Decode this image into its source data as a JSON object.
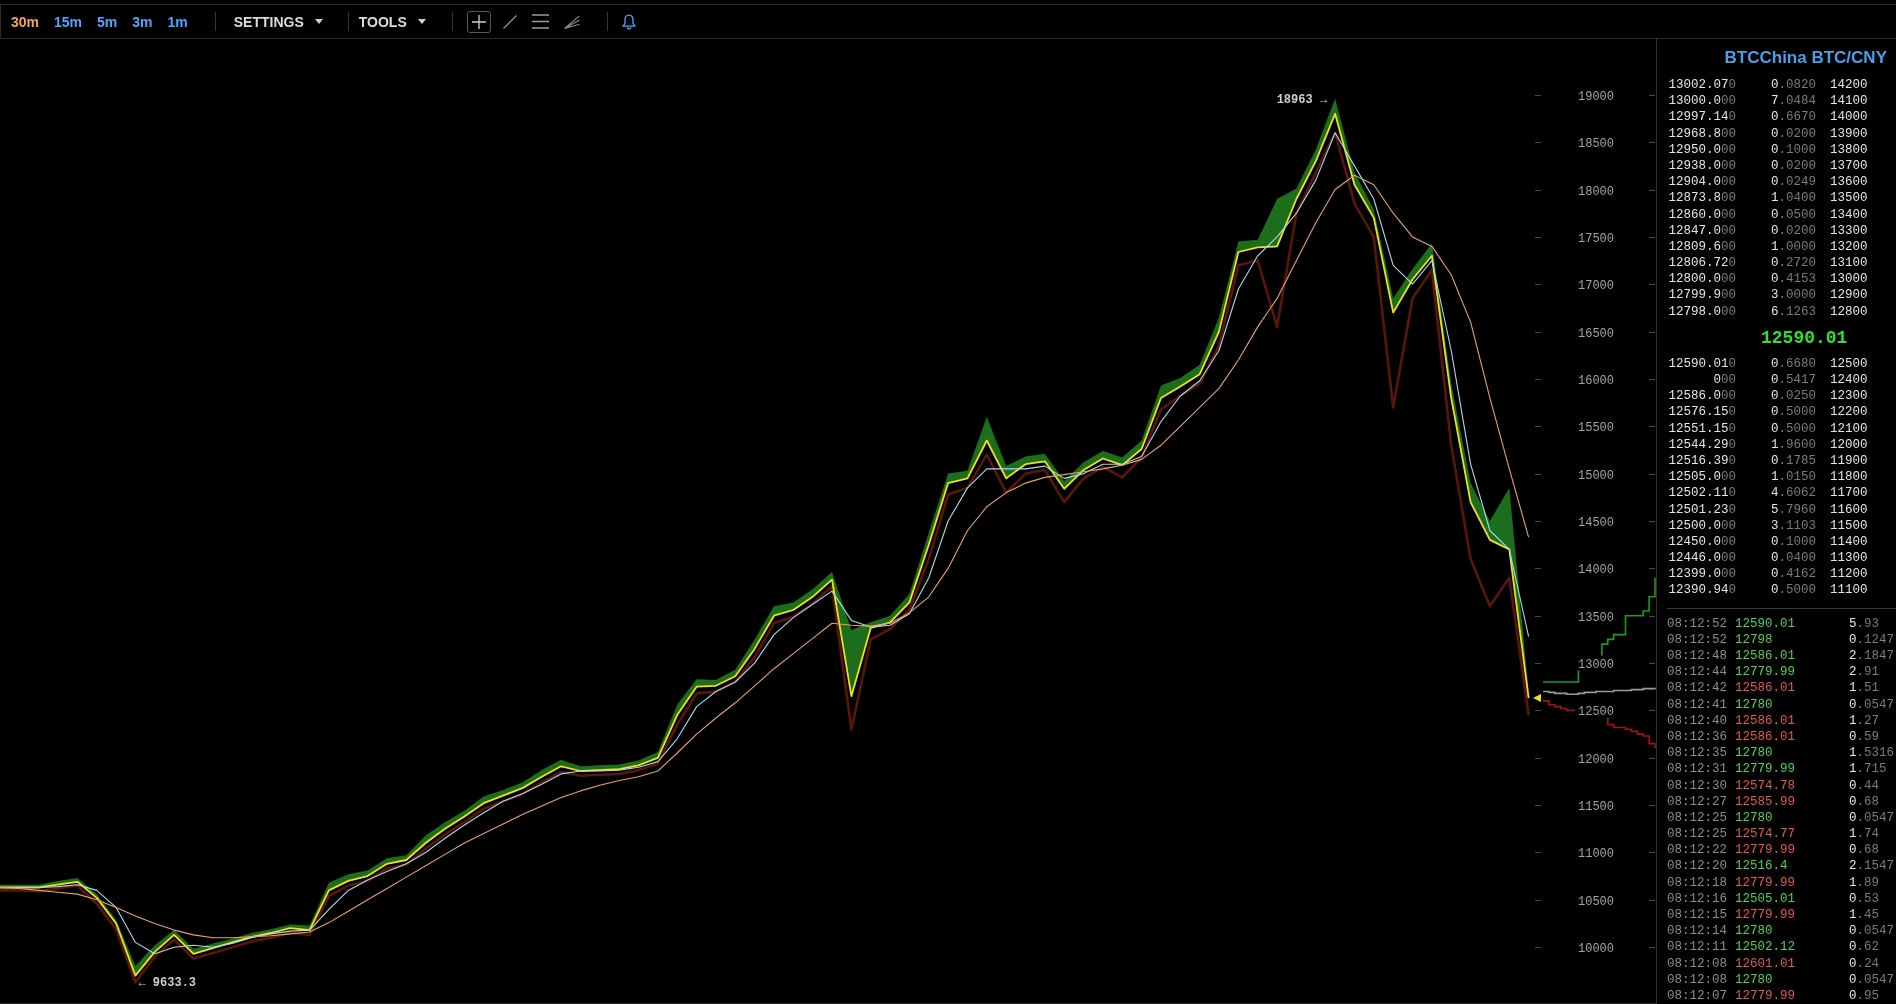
{
  "toolbar": {
    "intervals": [
      {
        "label": "30m",
        "selected": true
      },
      {
        "label": "15m",
        "selected": false
      },
      {
        "label": "5m",
        "selected": false
      },
      {
        "label": "3m",
        "selected": false
      },
      {
        "label": "1m",
        "selected": false
      }
    ],
    "menus": [
      {
        "label": "SETTINGS"
      },
      {
        "label": "TOOLS"
      }
    ],
    "tools": [
      {
        "selected": true
      },
      {
        "selected": false
      },
      {
        "selected": false
      },
      {
        "selected": false
      }
    ]
  },
  "price_chart": {
    "chart_data": {
      "type": "line",
      "ylim": [
        9400,
        19600
      ],
      "yticks": [
        10000,
        10500,
        11000,
        11500,
        12000,
        12500,
        13000,
        13500,
        14000,
        14500,
        15000,
        15500,
        16000,
        16500,
        17000,
        17500,
        18000,
        18500,
        19000
      ],
      "series": [
        {
          "type": "area",
          "color": "#1c6e1c",
          "values": [
            10660,
            10660,
            10660,
            10700,
            10730,
            10560,
            10290,
            9800,
            10020,
            10180,
            9980,
            10040,
            10090,
            10150,
            10190,
            10240,
            10230,
            10680,
            10770,
            10810,
            10940,
            10970,
            11180,
            11320,
            11440,
            11590,
            11660,
            11740,
            11870,
            11980,
            11910,
            11920,
            11930,
            11970,
            12060,
            12560,
            12830,
            12820,
            12930,
            13250,
            13600,
            13640,
            13780,
            13960,
            13350,
            13430,
            13500,
            13730,
            14380,
            15000,
            15030,
            15600,
            15080,
            15180,
            15210,
            14920,
            15120,
            15240,
            15170,
            15350,
            15930,
            16010,
            16150,
            16650,
            17450,
            17470,
            17900,
            18010,
            18420,
            18960,
            18180,
            17790,
            16850,
            17160,
            17430,
            15950,
            14900,
            14500,
            14850,
            12700
          ]
        },
        {
          "type": "line",
          "color": "#5a1608",
          "values": [
            10600,
            10600,
            10590,
            10620,
            10650,
            10460,
            10190,
            9630,
            9900,
            10080,
            9880,
            9940,
            10000,
            10060,
            10100,
            10150,
            10130,
            10540,
            10650,
            10700,
            10830,
            10870,
            11040,
            11190,
            11320,
            11460,
            11540,
            11620,
            11740,
            11850,
            11810,
            11820,
            11830,
            11870,
            11940,
            12350,
            12680,
            12700,
            12800,
            13060,
            13420,
            13490,
            13630,
            13810,
            12300,
            13250,
            13360,
            13560,
            14100,
            14780,
            14850,
            15200,
            14800,
            15000,
            15040,
            14700,
            14950,
            15070,
            14960,
            15170,
            15680,
            15820,
            15950,
            16350,
            17200,
            17250,
            16550,
            17750,
            18180,
            18600,
            17850,
            17500,
            15700,
            16850,
            17150,
            15300,
            14100,
            13600,
            13900,
            12450
          ]
        },
        {
          "type": "line",
          "color": "#f0e01e",
          "values": [
            10630,
            10630,
            10630,
            10660,
            10690,
            10520,
            10250,
            9700,
            9950,
            10130,
            9930,
            9990,
            10050,
            10110,
            10150,
            10200,
            10180,
            10600,
            10700,
            10750,
            10880,
            10920,
            11100,
            11250,
            11380,
            11520,
            11600,
            11680,
            11800,
            11910,
            11860,
            11870,
            11880,
            11920,
            12000,
            12450,
            12750,
            12760,
            12860,
            13150,
            13500,
            13560,
            13700,
            13880,
            12650,
            13370,
            13430,
            13640,
            14250,
            14900,
            14950,
            15350,
            14950,
            15100,
            15130,
            14840,
            15040,
            15160,
            15090,
            15260,
            15800,
            15920,
            16050,
            16500,
            17340,
            17390,
            17400,
            17900,
            18300,
            18800,
            18050,
            17700,
            16700,
            17050,
            17300,
            15800,
            14700,
            14300,
            14200,
            12630
          ]
        },
        {
          "type": "line",
          "color": "#a8d8ee",
          "values": [
            10630,
            10630,
            10630,
            10640,
            10660,
            10600,
            10420,
            10050,
            9930,
            10000,
            10020,
            10000,
            10040,
            10100,
            10140,
            10170,
            10180,
            10400,
            10600,
            10710,
            10800,
            10880,
            11000,
            11150,
            11290,
            11420,
            11540,
            11620,
            11720,
            11830,
            11860,
            11860,
            11870,
            11900,
            11960,
            12200,
            12540,
            12700,
            12800,
            13000,
            13300,
            13480,
            13620,
            13760,
            13450,
            13380,
            13400,
            13520,
            13900,
            14500,
            14850,
            15050,
            15050,
            15050,
            15080,
            14950,
            15000,
            15100,
            15100,
            15180,
            15550,
            15820,
            15980,
            16300,
            16950,
            17300,
            17500,
            17750,
            18100,
            18600,
            18250,
            17900,
            17200,
            17000,
            17250,
            16300,
            15100,
            14400,
            14200,
            13280
          ]
        },
        {
          "type": "line",
          "color": "#e6a262",
          "values": [
            10630,
            10620,
            10600,
            10580,
            10560,
            10500,
            10420,
            10330,
            10250,
            10180,
            10130,
            10100,
            10100,
            10110,
            10120,
            10140,
            10160,
            10260,
            10380,
            10500,
            10620,
            10740,
            10860,
            10980,
            11100,
            11200,
            11300,
            11400,
            11490,
            11580,
            11650,
            11710,
            11760,
            11800,
            11860,
            12050,
            12250,
            12420,
            12580,
            12760,
            12940,
            13100,
            13260,
            13420,
            13400,
            13390,
            13420,
            13530,
            13700,
            14000,
            14400,
            14650,
            14800,
            14900,
            14960,
            14990,
            15020,
            15050,
            15090,
            15150,
            15300,
            15500,
            15700,
            15900,
            16200,
            16550,
            16850,
            17250,
            17650,
            18000,
            18150,
            18050,
            17750,
            17500,
            17400,
            17100,
            16600,
            15800,
            15050,
            14330
          ]
        }
      ],
      "annotations": [
        "18963 →",
        "← 9633.3"
      ]
    }
  },
  "order_book": {
    "title": "BTCChina BTC/CNY",
    "asks": [
      {
        "price": "13002.07",
        "price_tail": "0",
        "amount_int": "0",
        "amount_frac": ".0820",
        "column_3": "14200"
      },
      {
        "price": "13000.0",
        "price_tail": "00",
        "amount_int": "7",
        "amount_frac": ".0484",
        "column_3": "14100"
      },
      {
        "price": "12997.14",
        "price_tail": "0",
        "amount_int": "0",
        "amount_frac": ".6670",
        "column_3": "14000"
      },
      {
        "price": "12968.8",
        "price_tail": "00",
        "amount_int": "0",
        "amount_frac": ".0200",
        "column_3": "13900"
      },
      {
        "price": "12950.0",
        "price_tail": "00",
        "amount_int": "0",
        "amount_frac": ".1000",
        "column_3": "13800"
      },
      {
        "price": "12938.0",
        "price_tail": "00",
        "amount_int": "0",
        "amount_frac": ".0200",
        "column_3": "13700"
      },
      {
        "price": "12904.0",
        "price_tail": "00",
        "amount_int": "0",
        "amount_frac": ".0249",
        "column_3": "13600"
      },
      {
        "price": "12873.8",
        "price_tail": "00",
        "amount_int": "1",
        "amount_frac": ".0400",
        "column_3": "13500"
      },
      {
        "price": "12860.0",
        "price_tail": "00",
        "amount_int": "0",
        "amount_frac": ".0500",
        "column_3": "13400"
      },
      {
        "price": "12847.0",
        "price_tail": "00",
        "amount_int": "0",
        "amount_frac": ".0200",
        "column_3": "13300"
      },
      {
        "price": "12809.6",
        "price_tail": "00",
        "amount_int": "1",
        "amount_frac": ".0000",
        "column_3": "13200"
      },
      {
        "price": "12806.72",
        "price_tail": "0",
        "amount_int": "0",
        "amount_frac": ".2720",
        "column_3": "13100"
      },
      {
        "price": "12800.0",
        "price_tail": "00",
        "amount_int": "0",
        "amount_frac": ".4153",
        "column_3": "13000"
      },
      {
        "price": "12799.9",
        "price_tail": "00",
        "amount_int": "3",
        "amount_frac": ".0000",
        "column_3": "12900"
      },
      {
        "price": "12798.0",
        "price_tail": "00",
        "amount_int": "6",
        "amount_frac": ".1263",
        "column_3": "12800"
      }
    ],
    "last_price": "12590.01",
    "bids": [
      {
        "price": "12590.01",
        "price_tail": "0",
        "amount_int": "0",
        "amount_frac": ".6680",
        "column_3": "12500"
      },
      {
        "price": "0",
        "price_tail": "00",
        "amount_int": "0",
        "amount_frac": ".5417",
        "column_3": "12400"
      },
      {
        "price": "12586.0",
        "price_tail": "00",
        "amount_int": "0",
        "amount_frac": ".0250",
        "column_3": "12300"
      },
      {
        "price": "12576.15",
        "price_tail": "0",
        "amount_int": "0",
        "amount_frac": ".5000",
        "column_3": "12200"
      },
      {
        "price": "12551.15",
        "price_tail": "0",
        "amount_int": "0",
        "amount_frac": ".5000",
        "column_3": "12100"
      },
      {
        "price": "12544.29",
        "price_tail": "0",
        "amount_int": "1",
        "amount_frac": ".9600",
        "column_3": "12000"
      },
      {
        "price": "12516.39",
        "price_tail": "0",
        "amount_int": "0",
        "amount_frac": ".1785",
        "column_3": "11900"
      },
      {
        "price": "12505.0",
        "price_tail": "00",
        "amount_int": "1",
        "amount_frac": ".0150",
        "column_3": "11800"
      },
      {
        "price": "12502.11",
        "price_tail": "0",
        "amount_int": "4",
        "amount_frac": ".6062",
        "column_3": "11700"
      },
      {
        "price": "12501.23",
        "price_tail": "0",
        "amount_int": "5",
        "amount_frac": ".7960",
        "column_3": "11600"
      },
      {
        "price": "12500.0",
        "price_tail": "00",
        "amount_int": "3",
        "amount_frac": ".1103",
        "column_3": "11500"
      },
      {
        "price": "12450.0",
        "price_tail": "00",
        "amount_int": "0",
        "amount_frac": ".1000",
        "column_3": "11400"
      },
      {
        "price": "12446.0",
        "price_tail": "00",
        "amount_int": "0",
        "amount_frac": ".0400",
        "column_3": "11300"
      },
      {
        "price": "12399.0",
        "price_tail": "00",
        "amount_int": "0",
        "amount_frac": ".4162",
        "column_3": "11200"
      },
      {
        "price": "12390.94",
        "price_tail": "0",
        "amount_int": "0",
        "amount_frac": ".5000",
        "column_3": "11100"
      }
    ]
  },
  "trades": [
    {
      "time": "08:12:52",
      "price": "12590.01",
      "color": "#4cd34c",
      "size_int": "5",
      "size_frac": ".93"
    },
    {
      "time": "08:12:52",
      "price": "12798",
      "color": "#4cd34c",
      "size_int": "0",
      "size_frac": ".1247"
    },
    {
      "time": "08:12:48",
      "price": "12586.01",
      "color": "#4cd34c",
      "size_int": "2",
      "size_frac": ".1847"
    },
    {
      "time": "08:12:44",
      "price": "12779.99",
      "color": "#4cd34c",
      "size_int": "2",
      "size_frac": ".91"
    },
    {
      "time": "08:12:42",
      "price": "12586.01",
      "color": "#e2574f",
      "size_int": "1",
      "size_frac": ".51"
    },
    {
      "time": "08:12:41",
      "price": "12780",
      "color": "#4cd34c",
      "size_int": "0",
      "size_frac": ".0547"
    },
    {
      "time": "08:12:40",
      "price": "12586.01",
      "color": "#e2574f",
      "size_int": "1",
      "size_frac": ".27"
    },
    {
      "time": "08:12:36",
      "price": "12586.01",
      "color": "#e2574f",
      "size_int": "0",
      "size_frac": ".59"
    },
    {
      "time": "08:12:35",
      "price": "12780",
      "color": "#4cd34c",
      "size_int": "1",
      "size_frac": ".5316"
    },
    {
      "time": "08:12:31",
      "price": "12779.99",
      "color": "#4cd34c",
      "size_int": "1",
      "size_frac": ".715"
    },
    {
      "time": "08:12:30",
      "price": "12574.78",
      "color": "#e2574f",
      "size_int": "0",
      "size_frac": ".44"
    },
    {
      "time": "08:12:27",
      "price": "12585.99",
      "color": "#e2574f",
      "size_int": "0",
      "size_frac": ".68"
    },
    {
      "time": "08:12:25",
      "price": "12780",
      "color": "#4cd34c",
      "size_int": "0",
      "size_frac": ".0547"
    },
    {
      "time": "08:12:25",
      "price": "12574.77",
      "color": "#e2574f",
      "size_int": "1",
      "size_frac": ".74"
    },
    {
      "time": "08:12:22",
      "price": "12779.99",
      "color": "#e2574f",
      "size_int": "0",
      "size_frac": ".68"
    },
    {
      "time": "08:12:20",
      "price": "12516.4",
      "color": "#4cd34c",
      "size_int": "2",
      "size_frac": ".1547"
    },
    {
      "time": "08:12:18",
      "price": "12779.99",
      "color": "#e2574f",
      "size_int": "1",
      "size_frac": ".89"
    },
    {
      "time": "08:12:16",
      "price": "12505.01",
      "color": "#4cd34c",
      "size_int": "0",
      "size_frac": ".53"
    },
    {
      "time": "08:12:15",
      "price": "12779.99",
      "color": "#e2574f",
      "size_int": "1",
      "size_frac": ".45"
    },
    {
      "time": "08:12:14",
      "price": "12780",
      "color": "#4cd34c",
      "size_int": "0",
      "size_frac": ".0547"
    },
    {
      "time": "08:12:11",
      "price": "12502.12",
      "color": "#4cd34c",
      "size_int": "0",
      "size_frac": ".62"
    },
    {
      "time": "08:12:08",
      "price": "12601.01",
      "color": "#e2574f",
      "size_int": "0",
      "size_frac": ".24"
    },
    {
      "time": "08:12:08",
      "price": "12780",
      "color": "#4cd34c",
      "size_int": "0",
      "size_frac": ".0547"
    },
    {
      "time": "08:12:07",
      "price": "12779.99",
      "color": "#e2574f",
      "size_int": "0",
      "size_frac": ".95"
    }
  ]
}
